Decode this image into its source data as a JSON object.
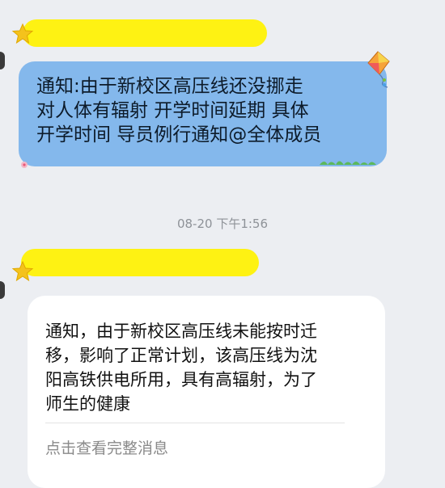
{
  "message1": {
    "lines": [
      "通知:由于新校区高压线还没挪走",
      "对人体有辐射 开学时间延期   具体",
      "开学时间 导员例行通知@全体成员"
    ]
  },
  "timestamp": "08-20 下午1:56",
  "message2": {
    "lines": [
      "通知，由于新校区高压线未能按时迁",
      "移，影响了正常计划，该高压线为沈",
      "阳高铁供电所用，具有高辐射，为了",
      "师生的健康"
    ],
    "view_full": "点击查看完整消息"
  },
  "colors": {
    "bubble_blue": "#84b8ec",
    "name_highlight": "#fff200",
    "background": "#eceef2"
  },
  "icons": [
    "star-badge-icon",
    "kite-icon"
  ]
}
